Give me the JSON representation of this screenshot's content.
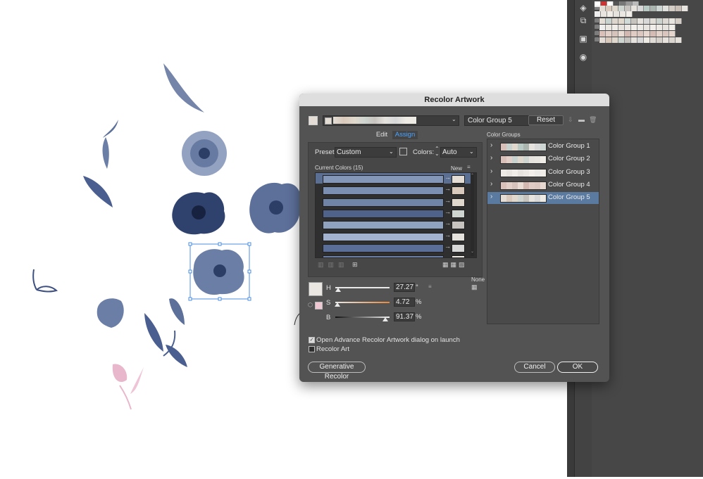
{
  "dialog": {
    "title": "Recolor Artwork",
    "group_name_value": "Color Group 5",
    "reset_label": "Reset",
    "tabs": [
      {
        "label": "Edit"
      },
      {
        "label": "Assign"
      }
    ],
    "preset_label": "Preset:",
    "preset_value": "Custom",
    "colors_label": "Colors:",
    "colors_value": "Auto",
    "current_colors_label": "Current Colors (15)",
    "new_label": "New",
    "none_label": "None",
    "hsb": {
      "h_label": "H",
      "h_value": "27.27",
      "h_unit": "°",
      "s_label": "S",
      "s_value": "4.72",
      "s_unit": "%",
      "b_label": "B",
      "b_value": "91.37",
      "b_unit": "%"
    },
    "checkbox_open_advanced": "Open Advance Recolor Artwork dialog on launch",
    "checkbox_recolor_art": "Recolor Art",
    "generative_recolor_label": "Generative Recolor",
    "cancel_label": "Cancel",
    "ok_label": "OK"
  },
  "color_groups": {
    "header": "Color Groups",
    "items": [
      {
        "label": "Color Group 1"
      },
      {
        "label": "Color Group 2"
      },
      {
        "label": "Color Group 3"
      },
      {
        "label": "Color Group 4"
      },
      {
        "label": "Color Group 5"
      }
    ]
  },
  "current_colors": [
    {
      "current": "#8497b8",
      "new": "#e3ddd6"
    },
    {
      "current": "#7b8fb3",
      "new": "#d9c9bc"
    },
    {
      "current": "#7084a8",
      "new": "#e0d8cc"
    },
    {
      "current": "#4f638a",
      "new": "#cfd5d0"
    },
    {
      "current": "#8fa2c0",
      "new": "#c7c4bf"
    },
    {
      "current": "#a3b3cf",
      "new": "#e6e3df"
    },
    {
      "current": "#5a6e98",
      "new": "#d8d8d8"
    },
    {
      "current": "#6a7ea6",
      "new": "#eeeae4"
    }
  ],
  "colors": {
    "dialog_bg": "#535353",
    "accent": "#2d7fd8",
    "selection": "#5a6f92",
    "artwork_blue": "#4a5f8f",
    "artwork_pink": "#e8b7cc"
  },
  "icons": [
    "swatch-icon",
    "chevron-down-icon",
    "folder-icon",
    "trash-icon",
    "layers-icon",
    "artboards-icon",
    "recolor-icon",
    "collapse-arrow-icon",
    "menu-icon"
  ]
}
